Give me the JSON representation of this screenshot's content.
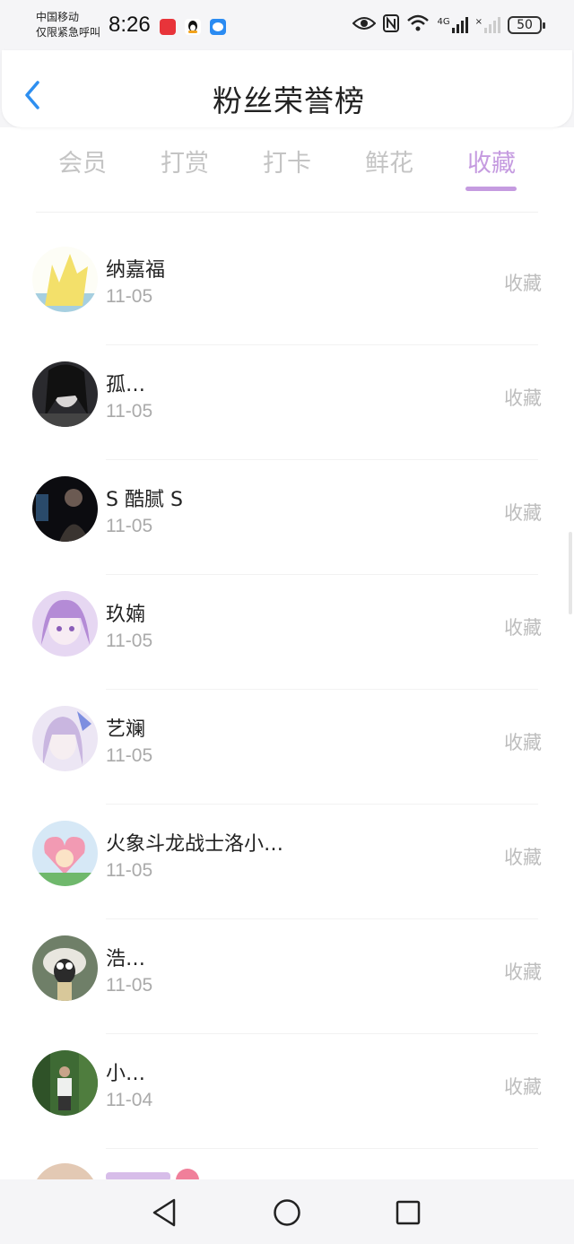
{
  "status": {
    "carrier_line1": "中国移动",
    "carrier_line2": "仅限紧急呼叫",
    "time": "8:26",
    "network": "4G",
    "battery": "50"
  },
  "header": {
    "title": "粉丝荣誉榜"
  },
  "tabs": [
    "会员",
    "打赏",
    "打卡",
    "鲜花",
    "收藏"
  ],
  "active_tab": "收藏",
  "fans": [
    {
      "name": "纳嘉福",
      "date": "11-05",
      "action": "收藏"
    },
    {
      "name": "孤…",
      "date": "11-05",
      "action": "收藏"
    },
    {
      "name": "S 酷腻 S",
      "date": "11-05",
      "action": "收藏"
    },
    {
      "name": "玖婻",
      "date": "11-05",
      "action": "收藏"
    },
    {
      "name": "艺斓",
      "date": "11-05",
      "action": "收藏"
    },
    {
      "name": "火象斗龙战士洛小…",
      "date": "11-05",
      "action": "收藏"
    },
    {
      "name": "浩…",
      "date": "11-05",
      "action": "收藏"
    },
    {
      "name": "小…",
      "date": "11-04",
      "action": "收藏"
    }
  ],
  "colors": {
    "accent": "#c59be0",
    "muted": "#bdbdbd",
    "back_arrow": "#2e8ff0"
  }
}
